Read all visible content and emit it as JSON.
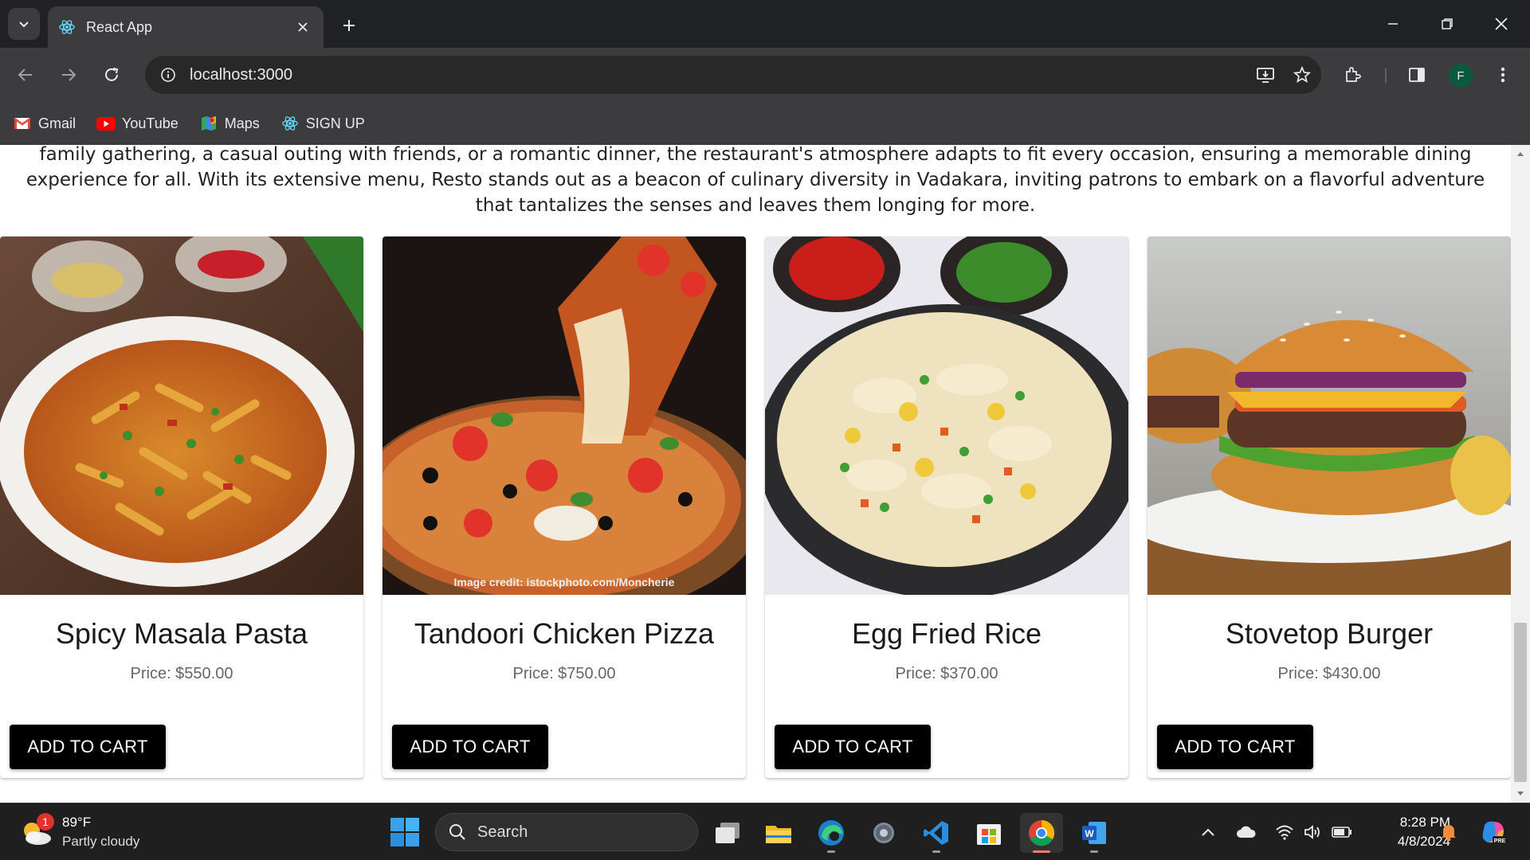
{
  "browser": {
    "tab_title": "React App",
    "url": "localhost:3000",
    "profile_initial": "F",
    "bookmarks": [
      {
        "label": "Gmail",
        "icon": "gmail-icon"
      },
      {
        "label": "YouTube",
        "icon": "youtube-icon"
      },
      {
        "label": "Maps",
        "icon": "maps-icon"
      },
      {
        "label": "SIGN UP",
        "icon": "react-icon"
      }
    ]
  },
  "page": {
    "intro_text": "family gathering, a casual outing with friends, or a romantic dinner, the restaurant's atmosphere adapts to fit every occasion, ensuring a memorable dining experience for all. With its extensive menu, Resto stands out as a beacon of culinary diversity in Vadakara, inviting patrons to embark on a flavorful adventure that tantalizes the senses and leaves them longing for more.",
    "cart_button_label": "ADD TO CART",
    "products": [
      {
        "name": "Spicy Masala Pasta",
        "price": "Price: $550.00",
        "image": "pasta bowl photo"
      },
      {
        "name": "Tandoori Chicken Pizza",
        "price": "Price: $750.00",
        "image": "pizza photo",
        "image_credit": "Image credit: istockphoto.com/Moncherie"
      },
      {
        "name": "Egg Fried Rice",
        "price": "Price: $370.00",
        "image": "fried rice photo"
      },
      {
        "name": "Stovetop Burger",
        "price": "Price: $430.00",
        "image": "burger photo"
      }
    ]
  },
  "taskbar": {
    "weather_temp": "89°F",
    "weather_condition": "Partly cloudy",
    "weather_badge": "1",
    "search_placeholder": "Search",
    "time": "8:28 PM",
    "date": "4/8/2024"
  },
  "colors": {
    "chrome_dark": "#202124",
    "chrome_toolbar": "#3c3c3f",
    "button_black": "#000000",
    "price_gray": "#666666",
    "taskbar_bg": "#1f1f1f"
  }
}
